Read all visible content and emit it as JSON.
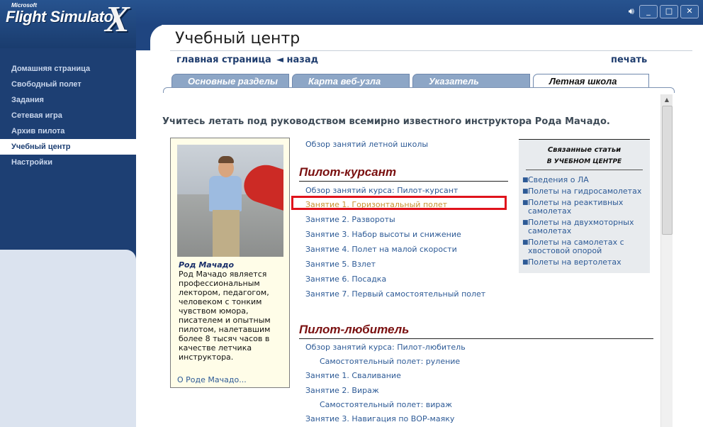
{
  "app": {
    "logo_small": "Microsoft",
    "logo_main": "Flight Simulator",
    "logo_x": "X",
    "window_controls": {
      "sound": "sound-icon",
      "minimize": "_",
      "maximize": "□",
      "close": "✕"
    }
  },
  "sidebar": {
    "items": [
      {
        "label": "Домашняя страница",
        "active": false
      },
      {
        "label": "Свободный полет",
        "active": false
      },
      {
        "label": "Задания",
        "active": false
      },
      {
        "label": "Сетевая игра",
        "active": false
      },
      {
        "label": "Архив пилота",
        "active": false
      },
      {
        "label": "Учебный центр",
        "active": true
      },
      {
        "label": "Настройки",
        "active": false
      }
    ]
  },
  "header": {
    "title": "Учебный центр",
    "home_link": "главная страница",
    "back_link": "◄ назад",
    "print_link": "печать"
  },
  "tabs": [
    {
      "label": "Основные разделы",
      "active": false
    },
    {
      "label": "Карта веб-узла",
      "active": false
    },
    {
      "label": "Указатель",
      "active": false
    },
    {
      "label": "Летная школа",
      "active": true
    }
  ],
  "main": {
    "intro": "Учитесь летать под руководством всемирно известного инструктора Рода Мачадо.",
    "overview_link": "Обзор занятий летной школы",
    "profile": {
      "name": "Род Мачадо",
      "bio": "Род Мачадо является профессиональным лектором, педагогом, человеком с тонким чувством юмора, писателем и опытным пилотом, налетавшим более 8 тысяч часов в качестве летчика инструктора.",
      "more_link": "О Роде Мачадо..."
    },
    "section1": {
      "heading": "Пилот-курсант",
      "links": [
        "Обзор занятий курса: Пилот-курсант",
        "Занятие 1. Горизонтальный полет",
        "Занятие 2. Развороты",
        "Занятие 3. Набор высоты и снижение",
        "Занятие 4. Полет на малой скорости",
        "Занятие 5. Взлет",
        "Занятие 6. Посадка",
        "Занятие 7. Первый самостоятельный полет"
      ]
    },
    "section2": {
      "heading": "Пилот-любитель",
      "links": [
        "Обзор занятий курса: Пилот-любитель",
        "Самостоятельный полет: руление",
        "Занятие 1. Сваливание",
        "Занятие 2. Вираж",
        "Самостоятельный полет: вираж",
        "Занятие 3. Навигация по ВОР-маяку"
      ]
    },
    "related": {
      "title_line1": "Связанные статьи",
      "title_line2": "в учебном центре",
      "items": [
        "Сведения о ЛА",
        "Полеты на гидросамолетах",
        "Полеты на реактивных самолетах",
        "Полеты на двухмоторных самолетах",
        "Полеты на самолетах с хвостовой опорой",
        "Полеты на вертолетах"
      ]
    }
  },
  "colors": {
    "sidebar": "#1d3f73",
    "link": "#2d5a96",
    "visited_link": "#c99231",
    "section_heading": "#7a1010",
    "highlight": "#e0131c"
  }
}
